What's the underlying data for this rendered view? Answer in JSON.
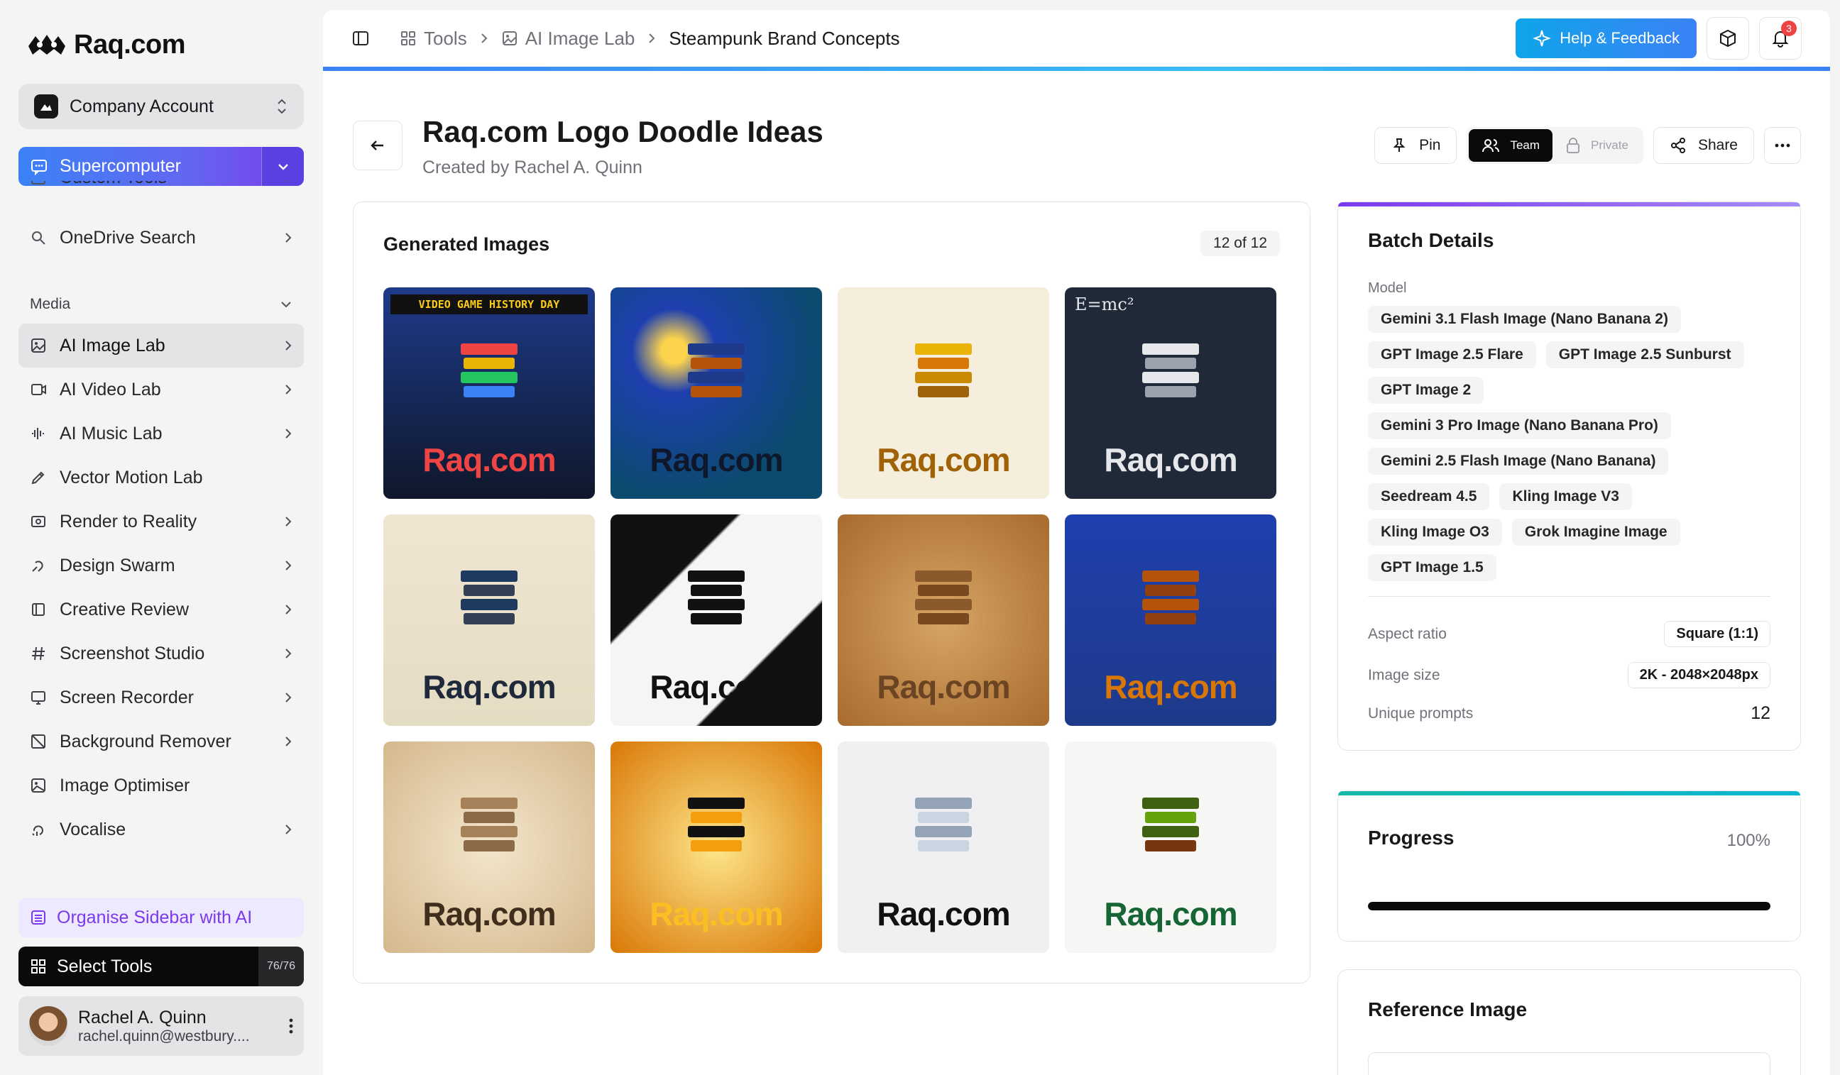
{
  "brand": {
    "name": "Raq.com"
  },
  "account": {
    "label": "Company Account"
  },
  "supercomputer": {
    "label": "Supercomputer"
  },
  "sidebar": {
    "partial_items": [
      {
        "label": "Custom Tools"
      },
      {
        "label": "OneDrive Search"
      }
    ],
    "media_section": "Media",
    "items": [
      {
        "label": "AI Image Lab",
        "icon": "image-icon",
        "active": true
      },
      {
        "label": "AI Video Lab",
        "icon": "video-icon"
      },
      {
        "label": "AI Music Lab",
        "icon": "waveform-icon"
      },
      {
        "label": "Vector Motion Lab",
        "icon": "pen-icon"
      },
      {
        "label": "Render to Reality",
        "icon": "render-icon"
      },
      {
        "label": "Design Swarm",
        "icon": "swarm-icon"
      },
      {
        "label": "Creative Review",
        "icon": "review-icon"
      },
      {
        "label": "Screenshot Studio",
        "icon": "hash-icon"
      },
      {
        "label": "Screen Recorder",
        "icon": "monitor-icon"
      },
      {
        "label": "Background Remover",
        "icon": "eraser-icon"
      },
      {
        "label": "Image Optimiser",
        "icon": "image-optimise-icon"
      },
      {
        "label": "Vocalise",
        "icon": "voice-icon"
      }
    ],
    "organise": "Organise Sidebar with AI",
    "select_tools": "Select Tools",
    "select_tools_count": "76/76"
  },
  "user": {
    "name": "Rachel A. Quinn",
    "email": "rachel.quinn@westbury...."
  },
  "topbar": {
    "breadcrumbs": [
      "Tools",
      "AI Image Lab",
      "Steampunk Brand Concepts"
    ],
    "help": "Help & Feedback",
    "notifications": "3"
  },
  "page": {
    "title": "Raq.com Logo Doodle Ideas",
    "subtitle": "Created by Rachel A. Quinn",
    "pin": "Pin",
    "team": "Team",
    "private": "Private",
    "share": "Share"
  },
  "gallery": {
    "title": "Generated Images",
    "count": "12 of 12",
    "tiles": [
      {
        "text": "Raq.com",
        "banner": "VIDEO GAME HISTORY DAY",
        "style": "arcade"
      },
      {
        "text": "Raq.com",
        "style": "starry-night"
      },
      {
        "text": "Raq.com",
        "style": "golden-3d"
      },
      {
        "text": "Raq.com",
        "eq": "E=mc²",
        "style": "chalkboard"
      },
      {
        "text": "Raq.com",
        "style": "great-wave"
      },
      {
        "text": "Raq.com",
        "style": "piano"
      },
      {
        "text": "Raq.com",
        "style": "sandstone"
      },
      {
        "text": "Raq.com",
        "style": "steampunk-blueprint"
      },
      {
        "text": "Raq.com",
        "style": "sepia-wood"
      },
      {
        "text": "Raq.com",
        "style": "honey"
      },
      {
        "text": "Raq.com",
        "style": "glass-blueprint"
      },
      {
        "text": "Raq.com",
        "style": "mossy"
      }
    ]
  },
  "batch": {
    "title": "Batch Details",
    "model_label": "Model",
    "models": [
      "Gemini 3.1 Flash Image (Nano Banana 2)",
      "GPT Image 2.5 Flare",
      "GPT Image 2.5 Sunburst",
      "GPT Image 2",
      "Gemini 3 Pro Image (Nano Banana Pro)",
      "Gemini 2.5 Flash Image (Nano Banana)",
      "Seedream 4.5",
      "Kling Image V3",
      "Kling Image O3",
      "Grok Imagine Image",
      "GPT Image 1.5"
    ],
    "aspect_label": "Aspect ratio",
    "aspect_value": "Square (1:1)",
    "size_label": "Image size",
    "size_value": "2K - 2048×2048px",
    "prompts_label": "Unique prompts",
    "prompts_value": "12"
  },
  "progress": {
    "title": "Progress",
    "percent_label": "100%",
    "value": 1.0
  },
  "reference": {
    "title": "Reference Image"
  },
  "colors": {
    "accent": "#3b82f6",
    "purple": "#7c3aed",
    "teal": "#14b8a6"
  }
}
